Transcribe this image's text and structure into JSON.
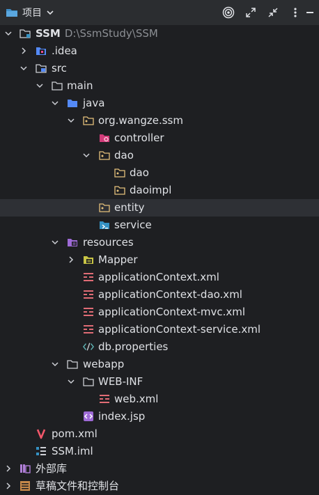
{
  "toolbar": {
    "title": "项目",
    "icons": [
      "project-folder-icon",
      "chevron-down-icon",
      "target-icon",
      "expand-icon",
      "collapse-icon",
      "more-vert-icon",
      "minimize-icon"
    ]
  },
  "tree": {
    "root": {
      "label": "SSM",
      "path": "D:\\SsmStudy\\SSM"
    },
    "idea": ".idea",
    "src": "src",
    "main": "main",
    "java": "java",
    "pkg": "org.wangze.ssm",
    "controller": "controller",
    "dao": "dao",
    "dao_dao": "dao",
    "daoimpl": "daoimpl",
    "entity": "entity",
    "service": "service",
    "resources": "resources",
    "mapper": "Mapper",
    "appctx": "applicationContext.xml",
    "appctx_dao": "applicationContext-dao.xml",
    "appctx_mvc": "applicationContext-mvc.xml",
    "appctx_service": "applicationContext-service.xml",
    "dbprops": "db.properties",
    "webapp": "webapp",
    "webinf": "WEB-INF",
    "webxml": "web.xml",
    "indexjsp": "index.jsp",
    "pom": "pom.xml",
    "iml": "SSM.iml",
    "extlib": "外部库",
    "scratches": "草稿文件和控制台"
  },
  "colors": {
    "background": "#1e1f22",
    "toolbar": "#2b2d30",
    "selected_row": "#2e3035",
    "folder": "#ced0d6",
    "source_folder": "#548af7",
    "package_folder": "#e5c07b",
    "xml": "#e06c75",
    "maven": "#f2576a",
    "module": "#3592c4"
  }
}
